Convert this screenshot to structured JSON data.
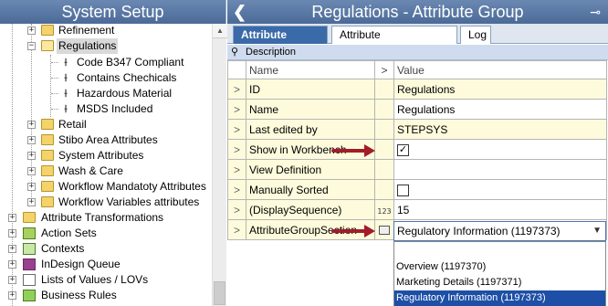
{
  "left_pane": {
    "title": "System Setup",
    "tree": [
      {
        "label": "Refinement",
        "icon": "folder-icon"
      },
      {
        "label": "Regulations",
        "icon": "folder-open-icon",
        "selected": true
      },
      {
        "label": "Code B347 Compliant",
        "icon": "attribute-icon"
      },
      {
        "label": "Contains Chechicals",
        "icon": "attribute-icon"
      },
      {
        "label": "Hazardous Material",
        "icon": "attribute-icon"
      },
      {
        "label": "MSDS Included",
        "icon": "attribute-icon"
      },
      {
        "label": "Retail",
        "icon": "folder-icon"
      },
      {
        "label": "Stibo Area Attributes",
        "icon": "folder-icon"
      },
      {
        "label": "System Attributes",
        "icon": "folder-icon"
      },
      {
        "label": "Wash & Care",
        "icon": "folder-icon"
      },
      {
        "label": "Workflow Mandatoty Attributes",
        "icon": "folder-icon"
      },
      {
        "label": "Workflow Variables attributes",
        "icon": "folder-icon"
      },
      {
        "label": "Attribute Transformations",
        "icon": "folder-icon"
      },
      {
        "label": "Action Sets",
        "icon": "action-sets-icon"
      },
      {
        "label": "Contexts",
        "icon": "contexts-icon"
      },
      {
        "label": "InDesign Queue",
        "icon": "indesign-icon"
      },
      {
        "label": "Lists of Values / LOVs",
        "icon": "lov-icon"
      },
      {
        "label": "Business Rules",
        "icon": "business-rules-icon"
      }
    ]
  },
  "right_pane": {
    "title": "Regulations - Attribute Group",
    "back_glyph": "❮",
    "pin_glyph": "⊸",
    "tabs": [
      "Attribute Group",
      "Attribute Transformation",
      "Log"
    ],
    "active_tab": "Attribute Group",
    "description_label": "Description",
    "grid": {
      "headers": {
        "name": "Name",
        "value": "Value",
        "expander": ">"
      },
      "rows": [
        {
          "name": "ID",
          "value": "Regulations"
        },
        {
          "name": "Name",
          "value": "Regulations"
        },
        {
          "name": "Last edited by",
          "value": "STEPSYS"
        },
        {
          "name": "Show in Workbench",
          "value": "✓",
          "checkbox": true,
          "checked": true
        },
        {
          "name": "View Definition",
          "value": ""
        },
        {
          "name": "Manually Sorted",
          "value": "",
          "checkbox": true,
          "checked": false
        },
        {
          "name": "(DisplaySequence)",
          "value": "15",
          "badge": "123"
        },
        {
          "name": "AttributeGroupSection",
          "value": "Regulatory Information (1197373)"
        }
      ],
      "row_expander": ">"
    },
    "dropdown": {
      "selected": "Regulatory Information (1197373)",
      "options": [
        "Overview (1197370)",
        "Marketing Details (1197371)",
        "Regulatory Information (1197373)"
      ],
      "highlighted": "Regulatory Information (1197373)"
    },
    "colors": {
      "header_bg": "#4b6a97",
      "active_tab": "#3b6aa8",
      "property_bg": "#fdfbdc",
      "arrow": "#a11d2a",
      "selection": "#1d4fa6"
    }
  }
}
